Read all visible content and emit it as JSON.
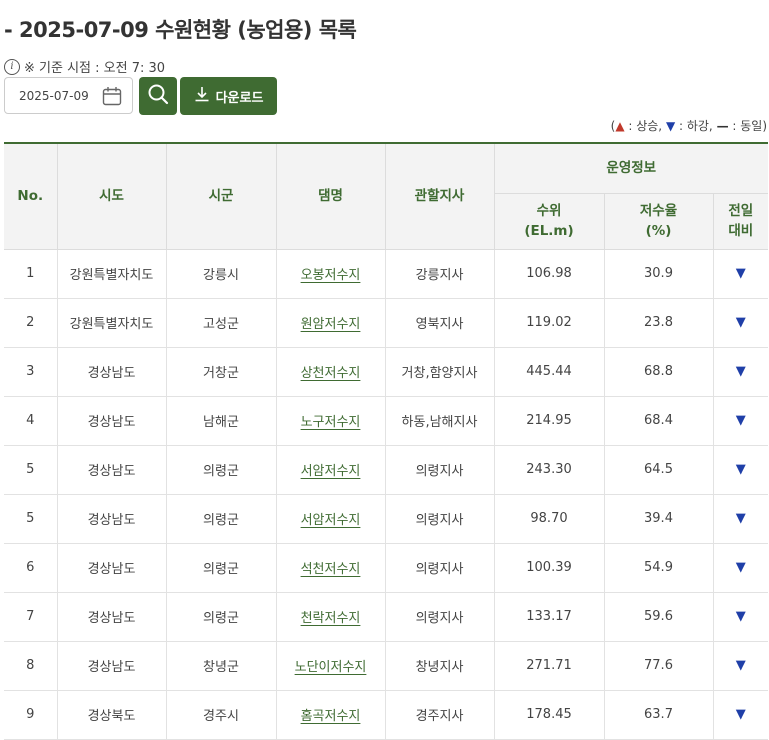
{
  "page": {
    "title": "- 2025-07-09 수원현황 (농업용) 목록",
    "info_icon": "info-icon",
    "base_time": "※ 기준 시점 : 오전 7: 30",
    "date_value": "2025-07-09",
    "download_label": "다운로드",
    "accent_color": "#3f6b32"
  },
  "legend": {
    "open": "(",
    "up_symbol": "▲",
    "up_text": " : 상승, ",
    "down_symbol": "▼",
    "down_text": " : 하강, ",
    "same_symbol": "—",
    "same_text": " : 동일)"
  },
  "table": {
    "headers": {
      "no": "No.",
      "sido": "시도",
      "sigun": "시군",
      "dam": "댐명",
      "branch": "관할지사",
      "group": "운영정보",
      "level_1": "수위",
      "level_2": "(EL.m)",
      "rate_1": "저수율",
      "rate_2": "(%)",
      "prev_1": "전일",
      "prev_2": "대비"
    },
    "rows": [
      {
        "no": "1",
        "sido": "강원특별자치도",
        "sigun": "강릉시",
        "dam": "오봉저수지",
        "branch": "강릉지사",
        "level": "106.98",
        "rate": "30.9",
        "change": "▼"
      },
      {
        "no": "2",
        "sido": "강원특별자치도",
        "sigun": "고성군",
        "dam": "원암저수지",
        "branch": "영북지사",
        "level": "119.02",
        "rate": "23.8",
        "change": "▼"
      },
      {
        "no": "3",
        "sido": "경상남도",
        "sigun": "거창군",
        "dam": "상천저수지",
        "branch": "거창,함양지사",
        "level": "445.44",
        "rate": "68.8",
        "change": "▼"
      },
      {
        "no": "4",
        "sido": "경상남도",
        "sigun": "남해군",
        "dam": "노구저수지",
        "branch": "하동,남해지사",
        "level": "214.95",
        "rate": "68.4",
        "change": "▼"
      },
      {
        "no": "5",
        "sido": "경상남도",
        "sigun": "의령군",
        "dam": "서암저수지",
        "branch": "의령지사",
        "level": "243.30",
        "rate": "64.5",
        "change": "▼"
      },
      {
        "no": "5",
        "sido": "경상남도",
        "sigun": "의령군",
        "dam": "서암저수지",
        "branch": "의령지사",
        "level": "98.70",
        "rate": "39.4",
        "change": "▼"
      },
      {
        "no": "6",
        "sido": "경상남도",
        "sigun": "의령군",
        "dam": "석천저수지",
        "branch": "의령지사",
        "level": "100.39",
        "rate": "54.9",
        "change": "▼"
      },
      {
        "no": "7",
        "sido": "경상남도",
        "sigun": "의령군",
        "dam": "천락저수지",
        "branch": "의령지사",
        "level": "133.17",
        "rate": "59.6",
        "change": "▼"
      },
      {
        "no": "8",
        "sido": "경상남도",
        "sigun": "창녕군",
        "dam": "노단이저수지",
        "branch": "창녕지사",
        "level": "271.71",
        "rate": "77.6",
        "change": "▼"
      },
      {
        "no": "9",
        "sido": "경상북도",
        "sigun": "경주시",
        "dam": "홈곡저수지",
        "branch": "경주지사",
        "level": "178.45",
        "rate": "63.7",
        "change": "▼"
      }
    ]
  }
}
